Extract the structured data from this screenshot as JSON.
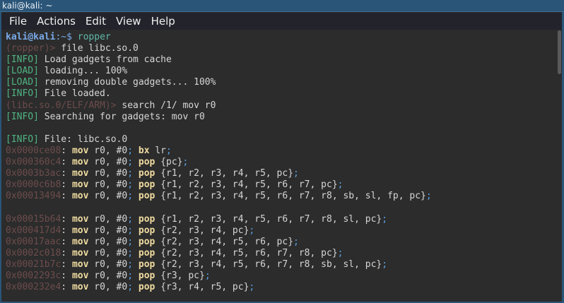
{
  "window": {
    "title": "kali@kali: ~"
  },
  "menu": [
    "File",
    "Actions",
    "Edit",
    "View",
    "Help"
  ],
  "colors": {
    "titlebar": "#2a5578",
    "menubar": "#22232b",
    "terminal_bg": "#2c2c2c"
  },
  "terminal": {
    "lines": [
      [
        {
          "t": "kali@kali",
          "s": "user"
        },
        {
          "t": ":~$ ",
          "s": "path"
        },
        {
          "t": "ropper",
          "s": "cmd"
        }
      ],
      [
        {
          "t": "(ropper)> ",
          "s": "prompt"
        },
        {
          "t": "file libc.so.0",
          "s": "text"
        }
      ],
      [
        {
          "t": "[INFO]",
          "s": "tag"
        },
        {
          "t": " Load gadgets from cache",
          "s": "text"
        }
      ],
      [
        {
          "t": "[LOAD]",
          "s": "tag"
        },
        {
          "t": " loading... 100%",
          "s": "text"
        }
      ],
      [
        {
          "t": "[LOAD]",
          "s": "tag"
        },
        {
          "t": " removing double gadgets... 100%",
          "s": "text"
        }
      ],
      [
        {
          "t": "[INFO]",
          "s": "tag"
        },
        {
          "t": " File loaded.",
          "s": "text"
        }
      ],
      [
        {
          "t": "(libc.so.0/ELF/ARM)> ",
          "s": "prompt"
        },
        {
          "t": "search /1/ mov r0",
          "s": "text"
        }
      ],
      [
        {
          "t": "[INFO]",
          "s": "tag"
        },
        {
          "t": " Searching for gadgets: mov r0",
          "s": "text"
        }
      ],
      [],
      [
        {
          "t": "[INFO]",
          "s": "tag"
        },
        {
          "t": " File: libc.so.0",
          "s": "text"
        }
      ],
      [
        {
          "t": "0x0000ce08",
          "s": "addr"
        },
        {
          "t": ": ",
          "s": "text"
        },
        {
          "t": "mov",
          "s": "op"
        },
        {
          "t": " r0, #0",
          "s": "text"
        },
        {
          "t": ";",
          "s": "semi"
        },
        {
          "t": " ",
          "s": "text"
        },
        {
          "t": "bx",
          "s": "op"
        },
        {
          "t": " lr",
          "s": "text"
        },
        {
          "t": ";",
          "s": "semi"
        }
      ],
      [
        {
          "t": "0x000360c4",
          "s": "addr"
        },
        {
          "t": ": ",
          "s": "text"
        },
        {
          "t": "mov",
          "s": "op"
        },
        {
          "t": " r0, #0",
          "s": "text"
        },
        {
          "t": ";",
          "s": "semi"
        },
        {
          "t": " ",
          "s": "text"
        },
        {
          "t": "pop",
          "s": "op"
        },
        {
          "t": " {pc}",
          "s": "text"
        },
        {
          "t": ";",
          "s": "semi"
        }
      ],
      [
        {
          "t": "0x0003b3ac",
          "s": "addr"
        },
        {
          "t": ": ",
          "s": "text"
        },
        {
          "t": "mov",
          "s": "op"
        },
        {
          "t": " r0, #0",
          "s": "text"
        },
        {
          "t": ";",
          "s": "semi"
        },
        {
          "t": " ",
          "s": "text"
        },
        {
          "t": "pop",
          "s": "op"
        },
        {
          "t": " {r1, r2, r3, r4, r5, pc}",
          "s": "text"
        },
        {
          "t": ";",
          "s": "semi"
        }
      ],
      [
        {
          "t": "0x0000c6b8",
          "s": "addr"
        },
        {
          "t": ": ",
          "s": "text"
        },
        {
          "t": "mov",
          "s": "op"
        },
        {
          "t": " r0, #0",
          "s": "text"
        },
        {
          "t": ";",
          "s": "semi"
        },
        {
          "t": " ",
          "s": "text"
        },
        {
          "t": "pop",
          "s": "op"
        },
        {
          "t": " {r1, r2, r3, r4, r5, r6, r7, pc}",
          "s": "text"
        },
        {
          "t": ";",
          "s": "semi"
        }
      ],
      [
        {
          "t": "0x00013494",
          "s": "addr"
        },
        {
          "t": ": ",
          "s": "text"
        },
        {
          "t": "mov",
          "s": "op"
        },
        {
          "t": " r0, #0",
          "s": "text"
        },
        {
          "t": ";",
          "s": "semi"
        },
        {
          "t": " ",
          "s": "text"
        },
        {
          "t": "pop",
          "s": "op"
        },
        {
          "t": " {r1, r2, r3, r4, r5, r6, r7, r8, sb, sl, fp, pc}",
          "s": "text"
        },
        {
          "t": ";",
          "s": "semi"
        }
      ],
      [],
      [
        {
          "t": "0x00015b64",
          "s": "addr"
        },
        {
          "t": ": ",
          "s": "text"
        },
        {
          "t": "mov",
          "s": "op"
        },
        {
          "t": " r0, #0",
          "s": "text"
        },
        {
          "t": ";",
          "s": "semi"
        },
        {
          "t": " ",
          "s": "text"
        },
        {
          "t": "pop",
          "s": "op"
        },
        {
          "t": " {r1, r2, r3, r4, r5, r6, r7, r8, sl, pc}",
          "s": "text"
        },
        {
          "t": ";",
          "s": "semi"
        }
      ],
      [
        {
          "t": "0x000417d4",
          "s": "addr"
        },
        {
          "t": ": ",
          "s": "text"
        },
        {
          "t": "mov",
          "s": "op"
        },
        {
          "t": " r0, #0",
          "s": "text"
        },
        {
          "t": ";",
          "s": "semi"
        },
        {
          "t": " ",
          "s": "text"
        },
        {
          "t": "pop",
          "s": "op"
        },
        {
          "t": " {r2, r3, r4, pc}",
          "s": "text"
        },
        {
          "t": ";",
          "s": "semi"
        }
      ],
      [
        {
          "t": "0x00017aac",
          "s": "addr"
        },
        {
          "t": ": ",
          "s": "text"
        },
        {
          "t": "mov",
          "s": "op"
        },
        {
          "t": " r0, #0",
          "s": "text"
        },
        {
          "t": ";",
          "s": "semi"
        },
        {
          "t": " ",
          "s": "text"
        },
        {
          "t": "pop",
          "s": "op"
        },
        {
          "t": " {r2, r3, r4, r5, r6, pc}",
          "s": "text"
        },
        {
          "t": ";",
          "s": "semi"
        }
      ],
      [
        {
          "t": "0x0002c018",
          "s": "addr"
        },
        {
          "t": ": ",
          "s": "text"
        },
        {
          "t": "mov",
          "s": "op"
        },
        {
          "t": " r0, #0",
          "s": "text"
        },
        {
          "t": ";",
          "s": "semi"
        },
        {
          "t": " ",
          "s": "text"
        },
        {
          "t": "pop",
          "s": "op"
        },
        {
          "t": " {r2, r3, r4, r5, r6, r7, r8, pc}",
          "s": "text"
        },
        {
          "t": ";",
          "s": "semi"
        }
      ],
      [
        {
          "t": "0x00021b7c",
          "s": "addr"
        },
        {
          "t": ": ",
          "s": "text"
        },
        {
          "t": "mov",
          "s": "op"
        },
        {
          "t": " r0, #0",
          "s": "text"
        },
        {
          "t": ";",
          "s": "semi"
        },
        {
          "t": " ",
          "s": "text"
        },
        {
          "t": "pop",
          "s": "op"
        },
        {
          "t": " {r2, r3, r4, r5, r6, r7, r8, sb, sl, pc}",
          "s": "text"
        },
        {
          "t": ";",
          "s": "semi"
        }
      ],
      [
        {
          "t": "0x0002293c",
          "s": "addr"
        },
        {
          "t": ": ",
          "s": "text"
        },
        {
          "t": "mov",
          "s": "op"
        },
        {
          "t": " r0, #0",
          "s": "text"
        },
        {
          "t": ";",
          "s": "semi"
        },
        {
          "t": " ",
          "s": "text"
        },
        {
          "t": "pop",
          "s": "op"
        },
        {
          "t": " {r3, pc}",
          "s": "text"
        },
        {
          "t": ";",
          "s": "semi"
        }
      ],
      [
        {
          "t": "0x000232e4",
          "s": "addr"
        },
        {
          "t": ": ",
          "s": "text"
        },
        {
          "t": "mov",
          "s": "op"
        },
        {
          "t": " r0, #0",
          "s": "text"
        },
        {
          "t": ";",
          "s": "semi"
        },
        {
          "t": " ",
          "s": "text"
        },
        {
          "t": "pop",
          "s": "op"
        },
        {
          "t": " {r3, r4, r5, pc}",
          "s": "text"
        },
        {
          "t": ";",
          "s": "semi"
        }
      ]
    ]
  }
}
